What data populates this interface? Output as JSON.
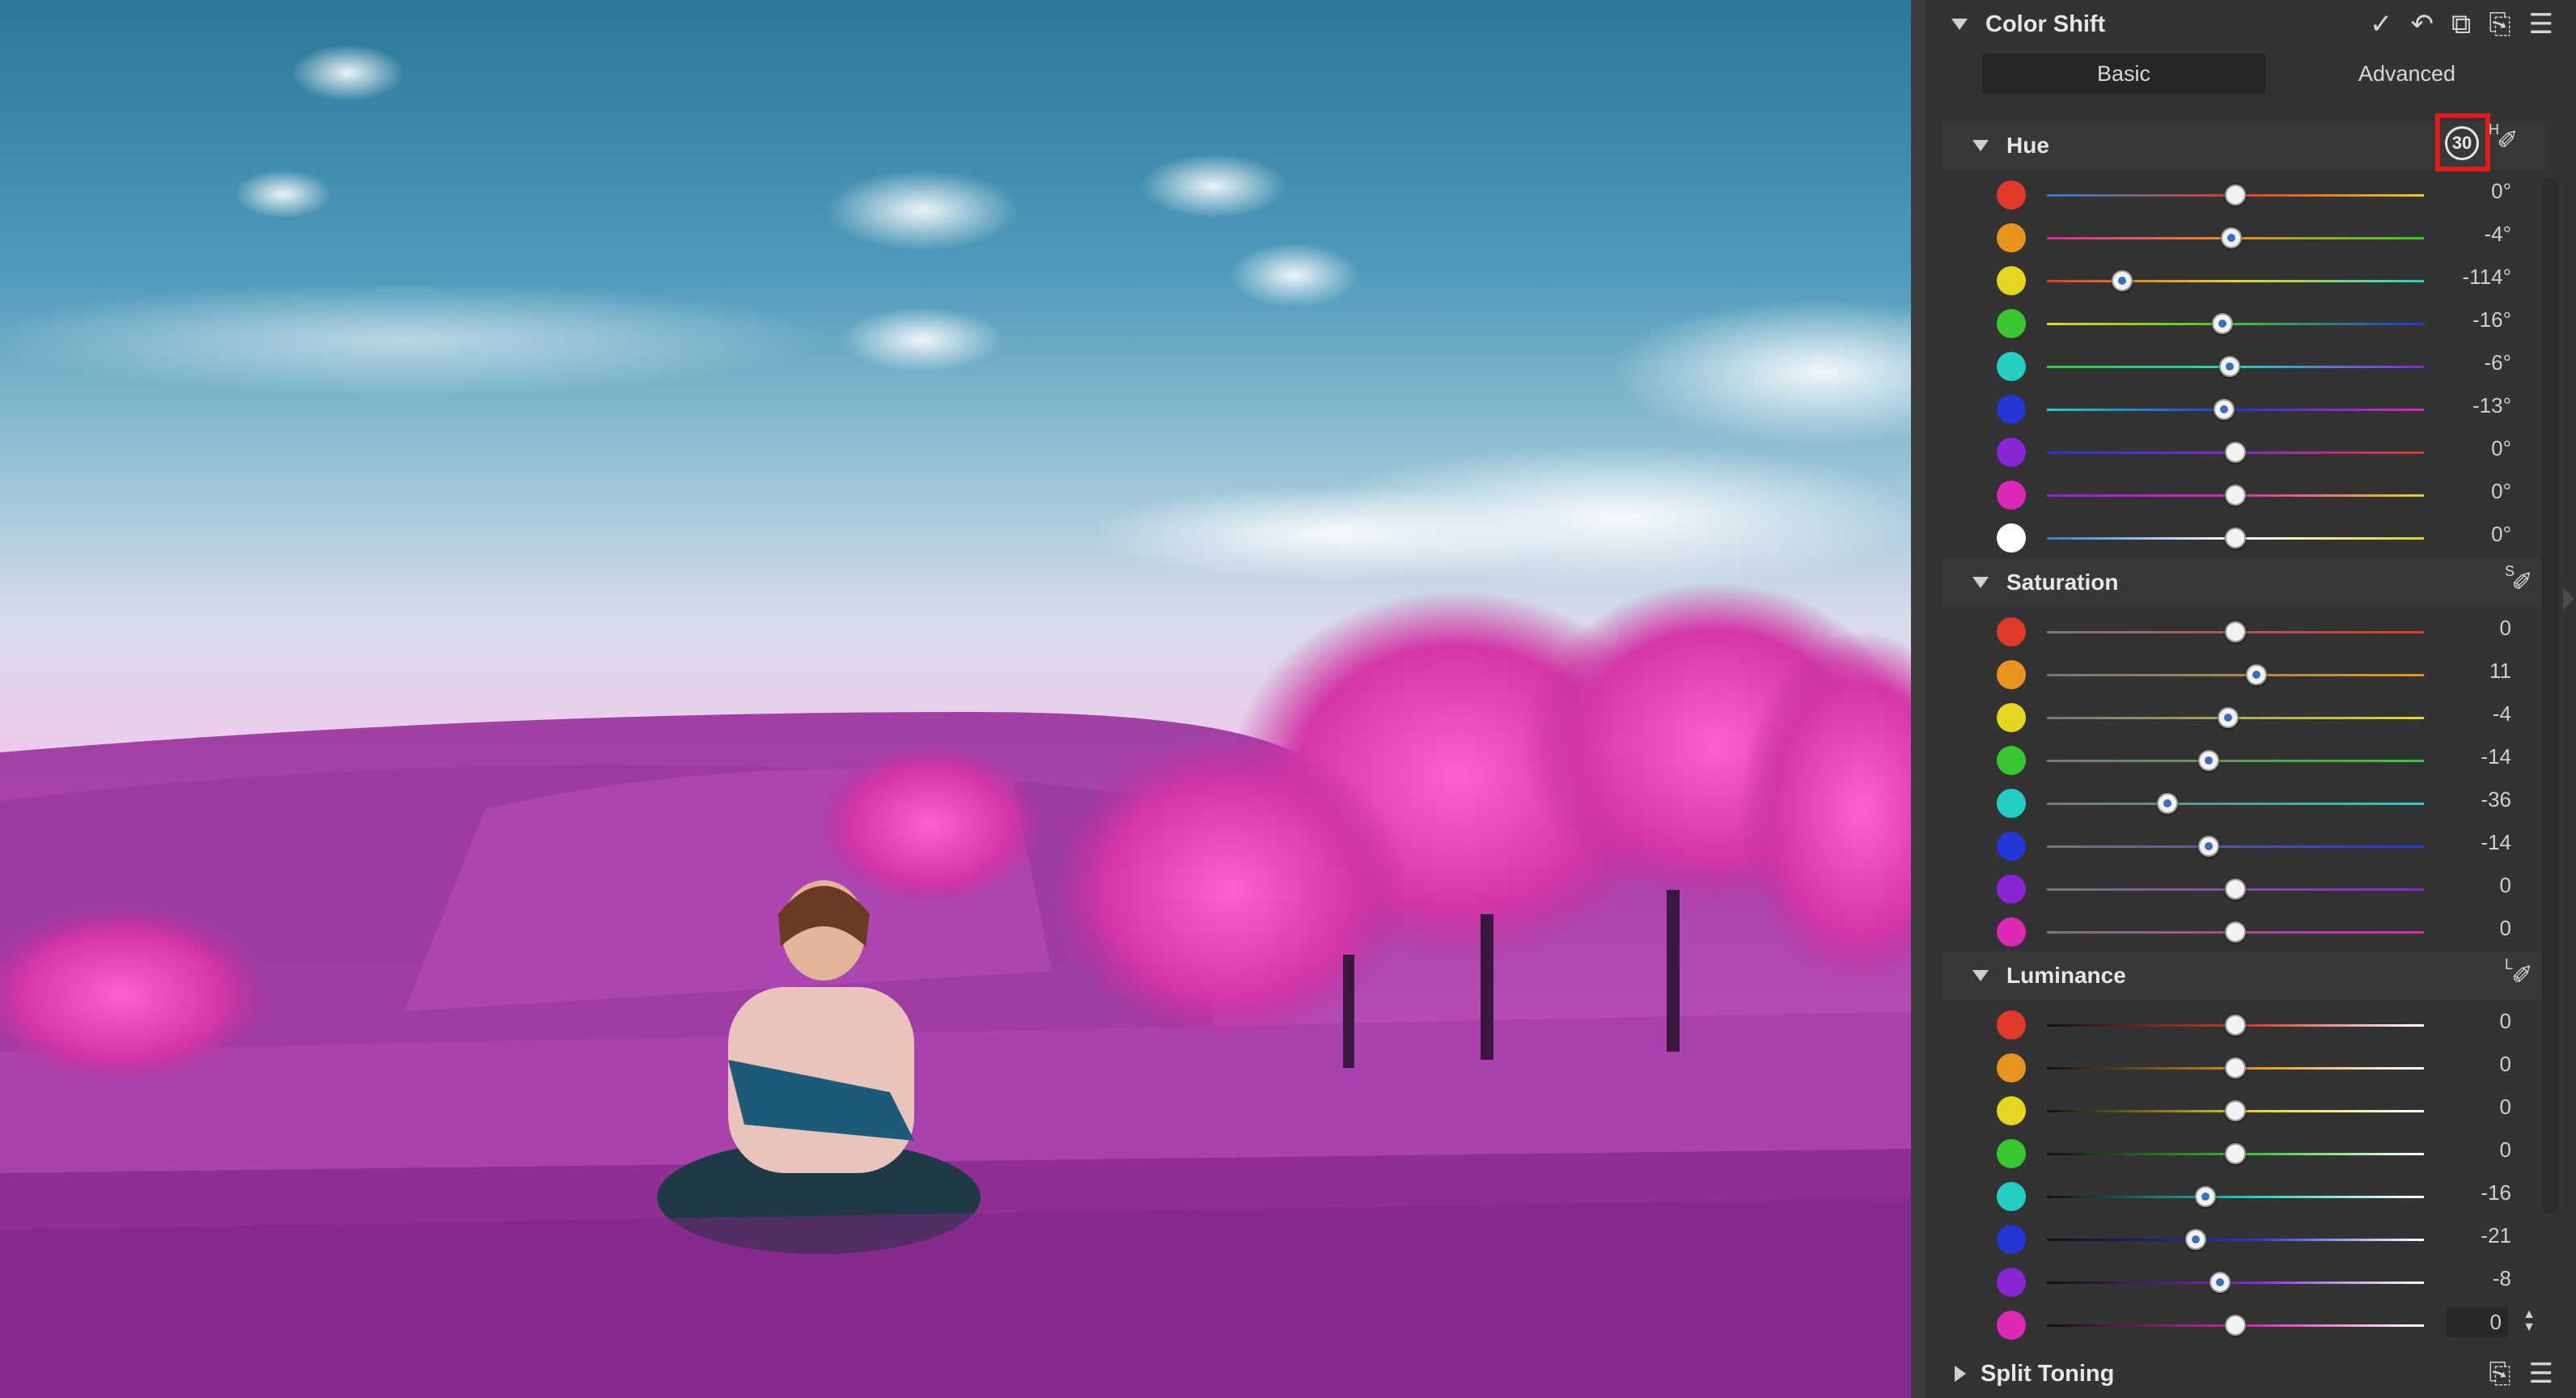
{
  "panel": {
    "title": "Color Shift",
    "header_icons": [
      "checkmark-icon",
      "undo-icon",
      "copy-icon",
      "paste-icon",
      "menu-icon"
    ],
    "tabs": [
      {
        "label": "Basic",
        "active": true
      },
      {
        "label": "Advanced",
        "active": false
      }
    ]
  },
  "hue": {
    "label": "Hue",
    "tool_letter": "H",
    "highlighted_icon_text": "30",
    "rows": [
      {
        "color": "#e03a2a",
        "value": "0°",
        "level": 0.5
      },
      {
        "color": "#e8931e",
        "value": "-4°",
        "level": 0.49
      },
      {
        "color": "#e6d61f",
        "value": "-114°",
        "level": 0.2
      },
      {
        "color": "#37c830",
        "value": "-16°",
        "level": 0.465
      },
      {
        "color": "#25cec4",
        "value": "-6°",
        "level": 0.485
      },
      {
        "color": "#2336d6",
        "value": "-13°",
        "level": 0.47
      },
      {
        "color": "#8a25d6",
        "value": "0°",
        "level": 0.5
      },
      {
        "color": "#db28b6",
        "value": "0°",
        "level": 0.5
      },
      {
        "color": "#ffffff",
        "value": "0°",
        "level": 0.5
      }
    ]
  },
  "saturation": {
    "label": "Saturation",
    "tool_letter": "S",
    "rows": [
      {
        "color": "#e03a2a",
        "value": "0",
        "level": 0.5
      },
      {
        "color": "#e8931e",
        "value": "11",
        "level": 0.555
      },
      {
        "color": "#e6d61f",
        "value": "-4",
        "level": 0.48
      },
      {
        "color": "#37c830",
        "value": "-14",
        "level": 0.43
      },
      {
        "color": "#25cec4",
        "value": "-36",
        "level": 0.32
      },
      {
        "color": "#2336d6",
        "value": "-14",
        "level": 0.43
      },
      {
        "color": "#8a25d6",
        "value": "0",
        "level": 0.5
      },
      {
        "color": "#db28b6",
        "value": "0",
        "level": 0.5
      }
    ]
  },
  "luminance": {
    "label": "Luminance",
    "tool_letter": "L",
    "rows": [
      {
        "color": "#e03a2a",
        "value": "0",
        "level": 0.5
      },
      {
        "color": "#e8931e",
        "value": "0",
        "level": 0.5
      },
      {
        "color": "#e6d61f",
        "value": "0",
        "level": 0.5
      },
      {
        "color": "#37c830",
        "value": "0",
        "level": 0.5
      },
      {
        "color": "#25cec4",
        "value": "-16",
        "level": 0.42
      },
      {
        "color": "#2336d6",
        "value": "-21",
        "level": 0.395
      },
      {
        "color": "#8a25d6",
        "value": "-8",
        "level": 0.46
      },
      {
        "color": "#db28b6",
        "value": "0",
        "level": 0.5
      }
    ]
  },
  "split_toning": {
    "label": "Split Toning",
    "header_icons": [
      "paste-icon",
      "menu-icon"
    ]
  },
  "track_gradients": {
    "hue": [
      "#2a7fd6,#e03a2a,#e0d020",
      "#d62a9a,#e8931e,#37c830",
      "#e03a2a,#e6d61f,#25cec4",
      "#e6d61f,#37c830,#2336d6",
      "#37c830,#25cec4,#8a25d6",
      "#25cec4,#2336d6,#db28b6",
      "#2336d6,#8a25d6,#e03a2a",
      "#8a25d6,#db28b6,#e6d61f",
      "#2a7fd6,#ffffff,#e0d020"
    ]
  }
}
